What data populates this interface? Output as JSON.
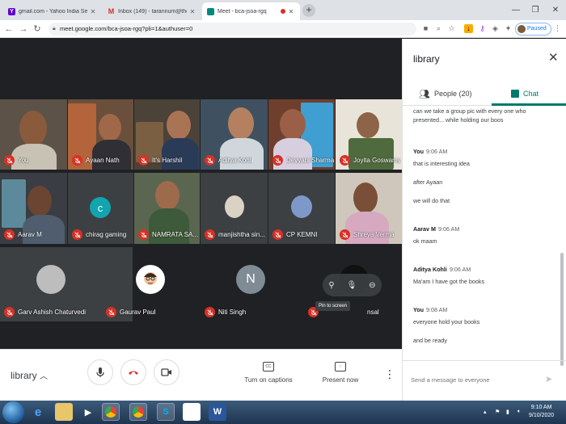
{
  "browser": {
    "tabs": [
      {
        "title": "gmail.com - Yahoo India Search R",
        "icon": "yahoo-icon",
        "color": "#6001d2"
      },
      {
        "title": "Inbox (149) - tarannum@theindi",
        "icon": "gmail-icon",
        "color": "#d93025"
      },
      {
        "title": "Meet - bca-jsoa-rgq",
        "icon": "meet-icon",
        "color": "#00897b"
      }
    ],
    "new_tab": "+",
    "url": "meet.google.com/bca-jsoa-rgq?pli=1&authuser=0",
    "profile_status": "Paused"
  },
  "meet": {
    "tiles": [
      {
        "name": "You"
      },
      {
        "name": "Ayaan Nath"
      },
      {
        "name": "It's Harshil"
      },
      {
        "name": "Aditya Kohli"
      },
      {
        "name": "Devyani Sharma"
      },
      {
        "name": "Joyita Goswamy"
      },
      {
        "name": "Aarav M"
      },
      {
        "name": "chirag gaming",
        "initial": "c",
        "color": "#12a4af"
      },
      {
        "name": "NAMRATA SA..."
      },
      {
        "name": "manjishtha sin..."
      },
      {
        "name": "CP KEMNI"
      },
      {
        "name": "Shreya Verma"
      },
      {
        "name": "Garv Ashish Chaturvedi"
      },
      {
        "name": "Gaurav Paul"
      },
      {
        "name": "Niti Singh",
        "initial": "N",
        "color": "#7f8c96"
      },
      {
        "name": "nsal"
      }
    ],
    "tooltip": "Pin to screen",
    "meeting_name": "library",
    "captions_label": "Turn on captions",
    "present_label": "Present now",
    "cc_text": "CC"
  },
  "panel": {
    "title": "library",
    "people_tab": "People (20)",
    "chat_tab": "Chat",
    "messages": [
      {
        "text": "can we take a group pic with every one who presented... while holding our boos"
      },
      {
        "sender": "You",
        "time": "9:06 AM"
      },
      {
        "text": "that is interesting idea"
      },
      {
        "text": "after Ayaan"
      },
      {
        "text": "we will do that"
      },
      {
        "sender": "Aarav M",
        "time": "9:06 AM"
      },
      {
        "text": "ok maam"
      },
      {
        "sender": "Aditya Kohli",
        "time": "9:06 AM"
      },
      {
        "text": "Ma'am I have got the books"
      },
      {
        "sender": "You",
        "time": "9:08 AM"
      },
      {
        "text": "everyone hold your books"
      },
      {
        "text": "and be ready"
      }
    ],
    "input_placeholder": "Send a message to everyone"
  },
  "taskbar": {
    "time": "9:10 AM",
    "date": "9/10/2020",
    "word_letter": "W",
    "skype_letter": "S"
  }
}
